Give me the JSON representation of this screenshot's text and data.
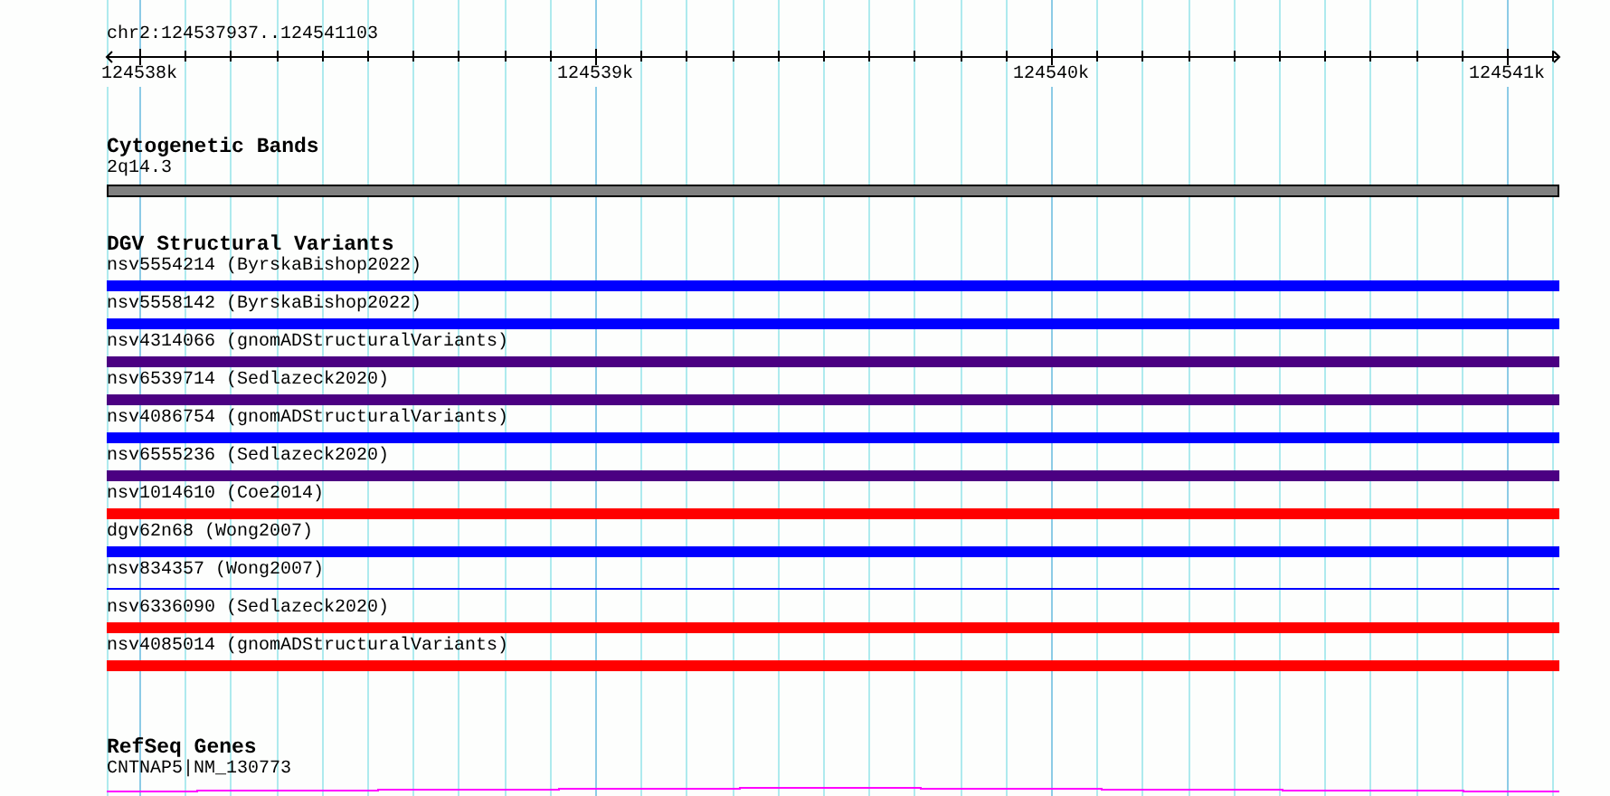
{
  "ruler": {
    "location": "chr2:124537937..124541103",
    "ticks": [
      "124538k",
      "124539k",
      "124540k",
      "124541k"
    ]
  },
  "tracks": [
    {
      "kind": "bands",
      "title": "Cytogenetic Bands",
      "features": [
        {
          "label": "2q14.3",
          "color": "#808080"
        }
      ]
    },
    {
      "kind": "variants",
      "title": "DGV Structural Variants",
      "features": [
        {
          "label": "nsv5554214 (ByrskaBishop2022)",
          "color": "#0000ff",
          "kind": "thick"
        },
        {
          "label": "nsv5558142 (ByrskaBishop2022)",
          "color": "#0000ff",
          "kind": "thick"
        },
        {
          "label": "nsv4314066 (gnomADStructuralVariants)",
          "color": "#4b0082",
          "kind": "thick"
        },
        {
          "label": "nsv6539714 (Sedlazeck2020)",
          "color": "#4b0082",
          "kind": "thick"
        },
        {
          "label": "nsv4086754 (gnomADStructuralVariants)",
          "color": "#0000ff",
          "kind": "thick"
        },
        {
          "label": "nsv6555236 (Sedlazeck2020)",
          "color": "#4b0082",
          "kind": "thick"
        },
        {
          "label": "nsv1014610 (Coe2014)",
          "color": "#ff0000",
          "kind": "thick"
        },
        {
          "label": "dgv62n68 (Wong2007)",
          "color": "#0000ff",
          "kind": "thick"
        },
        {
          "label": "nsv834357 (Wong2007)",
          "color": "#0000ff",
          "kind": "thin"
        },
        {
          "label": "nsv6336090 (Sedlazeck2020)",
          "color": "#ff0000",
          "kind": "thick"
        },
        {
          "label": "nsv4085014 (gnomADStructuralVariants)",
          "color": "#ff0000",
          "kind": "thick"
        }
      ]
    },
    {
      "kind": "genes",
      "title": "RefSeq Genes",
      "features": [
        {
          "label": "CNTNAP5|NM_130773",
          "color": "#ff00ff"
        }
      ]
    }
  ]
}
